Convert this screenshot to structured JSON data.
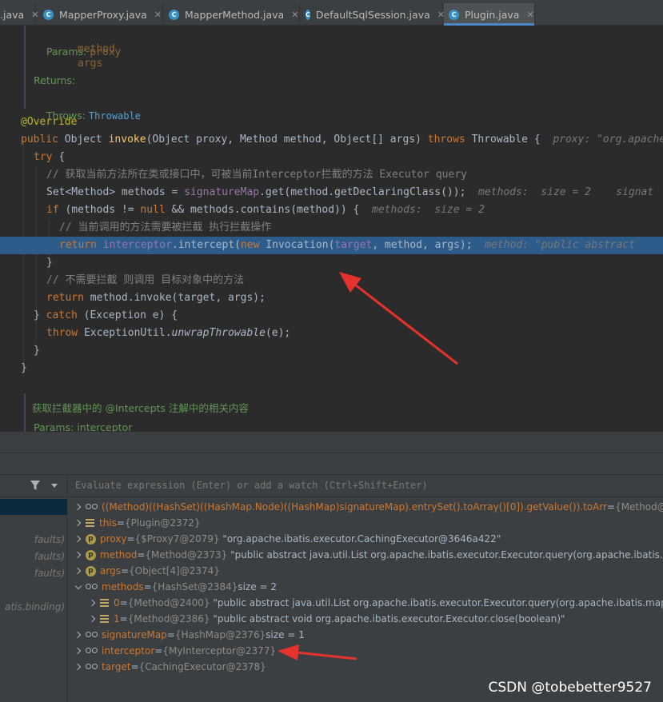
{
  "tabs": [
    {
      "label": ".java",
      "active": false,
      "icon": false
    },
    {
      "label": "MapperProxy.java",
      "active": false,
      "icon": true
    },
    {
      "label": "MapperMethod.java",
      "active": false,
      "icon": true
    },
    {
      "label": "DefaultSqlSession.java",
      "active": false,
      "icon": true
    },
    {
      "label": "Plugin.java",
      "active": true,
      "icon": true
    }
  ],
  "doc_top": {
    "params_label": "Params:",
    "params": [
      "proxy",
      "method",
      "args"
    ],
    "returns_label": "Returns:",
    "throws_label": "Throws:",
    "throws_value": "Throwable"
  },
  "code": {
    "override": "@Override",
    "sig_public": "public ",
    "sig_object": "Object ",
    "sig_invoke": "invoke",
    "sig_rest": "(Object proxy, Method method, Object[] args) ",
    "sig_throws": "throws ",
    "sig_throwable": "Throwable {",
    "sig_hint": "proxy: \"org.apache",
    "try_kw": "try ",
    "try_brace": "{",
    "comment1": "// 获取当前方法所在类或接口中，可被当前Interceptor拦截的方法 Executor query",
    "l3_a": "Set<Method> methods = ",
    "l3_field": "signatureMap",
    "l3_b": ".get(method.getDeclaringClass());",
    "l3_hint": "methods:  size = 2    signat",
    "l4_if": "if ",
    "l4_a": "(methods != ",
    "l4_null": "null",
    "l4_b": " && methods.contains(method)) {",
    "l4_hint": "methods:  size = 2",
    "comment2": "// 当前调用的方法需要被拦截 执行拦截操作",
    "l6_return": "return ",
    "l6_field": "interceptor",
    "l6_a": ".intercept(",
    "l6_new": "new ",
    "l6_b": "Invocation(",
    "l6_target": "target",
    "l6_c": ", method, args);",
    "l6_hint": "method: \"public abstract",
    "close1": "}",
    "comment3": "// 不需要拦截 则调用 目标对象中的方法",
    "l9_return": "return ",
    "l9_rest": "method.invoke(target, args);",
    "l10_close": "} ",
    "l10_catch": "catch ",
    "l10_rest": "(Exception e) {",
    "l11_throw": "throw ",
    "l11_a": "ExceptionUtil.",
    "l11_method": "unwrapThrowable",
    "l11_b": "(e);",
    "close2": "}",
    "close3": "}"
  },
  "doc_bottom": {
    "text": "获取拦截器中的 @Intercepts 注解中的相关内容",
    "params_partial": "Params: interceptor"
  },
  "frames": {
    "items": [
      "faults)",
      "faults)",
      "faults)",
      "atis.binding)"
    ]
  },
  "evaluate_placeholder": "Evaluate expression (Enter) or add a watch (Ctrl+Shift+Enter)",
  "variables": [
    {
      "name": "((Method)((HashSet)((HashMap.Node)((HashMap)signatureMap).entrySet().toArray()[0]).getValue()).toArr",
      "value": "{Method@238",
      "kind": "watch"
    },
    {
      "name": "this",
      "value": "{Plugin@2372}",
      "kind": "field"
    },
    {
      "name": "proxy",
      "value": "{$Proxy7@2079}",
      "extra": "\"org.apache.ibatis.executor.CachingExecutor@3646a422\"",
      "kind": "param"
    },
    {
      "name": "method",
      "value": "{Method@2373}",
      "extra": "\"public abstract java.util.List org.apache.ibatis.executor.Executor.query(org.apache.ibatis.mapp",
      "kind": "param"
    },
    {
      "name": "args",
      "value": "{Object[4]@2374}",
      "kind": "param"
    },
    {
      "name": "methods",
      "value": "{HashSet@2384}",
      "extra": " size = 2",
      "kind": "glasses-open"
    },
    {
      "name": "0",
      "value": "{Method@2400}",
      "extra": "\"public abstract java.util.List org.apache.ibatis.executor.Executor.query(org.apache.ibatis.mapping",
      "kind": "element"
    },
    {
      "name": "1",
      "value": "{Method@2386}",
      "extra": "\"public abstract void org.apache.ibatis.executor.Executor.close(boolean)\"",
      "kind": "element"
    },
    {
      "name": "signatureMap",
      "value": "{HashMap@2376}",
      "extra": " size = 1",
      "kind": "glasses"
    },
    {
      "name": "interceptor",
      "value": "{MyInterceptor@2377}",
      "kind": "glasses"
    },
    {
      "name": "target",
      "value": "{CachingExecutor@2378}",
      "kind": "glasses"
    }
  ],
  "var_eq": " = ",
  "watermark": "CSDN @tobebetter9527",
  "colors": {
    "highlight": "#2d5b8a",
    "arrow": "#e5322d",
    "accent": "#4a88c7"
  }
}
